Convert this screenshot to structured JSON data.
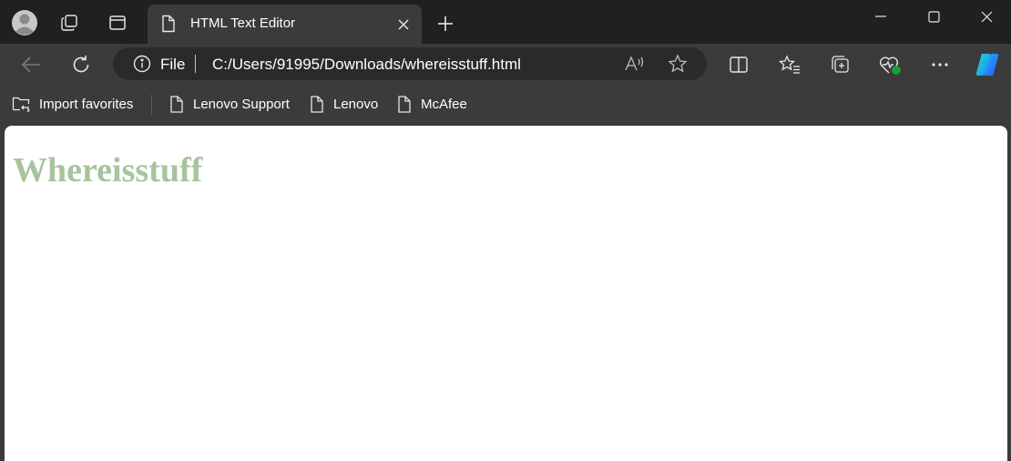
{
  "tab": {
    "title": "HTML Text Editor"
  },
  "address": {
    "scheme": "File",
    "url": "C:/Users/91995/Downloads/whereisstuff.html"
  },
  "favorites": [
    {
      "label": "Import favorites",
      "icon": "import-folder-icon"
    },
    {
      "label": "Lenovo Support",
      "icon": "page-icon"
    },
    {
      "label": "Lenovo",
      "icon": "page-icon"
    },
    {
      "label": "McAfee",
      "icon": "page-icon"
    }
  ],
  "page": {
    "heading": "Whereisstuff",
    "heading_color": "#a7c49d"
  },
  "colors": {
    "titlebar": "#202020",
    "toolbar": "#3b3b3b",
    "addressbar": "#2a2a2a",
    "health_dot": "#1f9d3a"
  }
}
